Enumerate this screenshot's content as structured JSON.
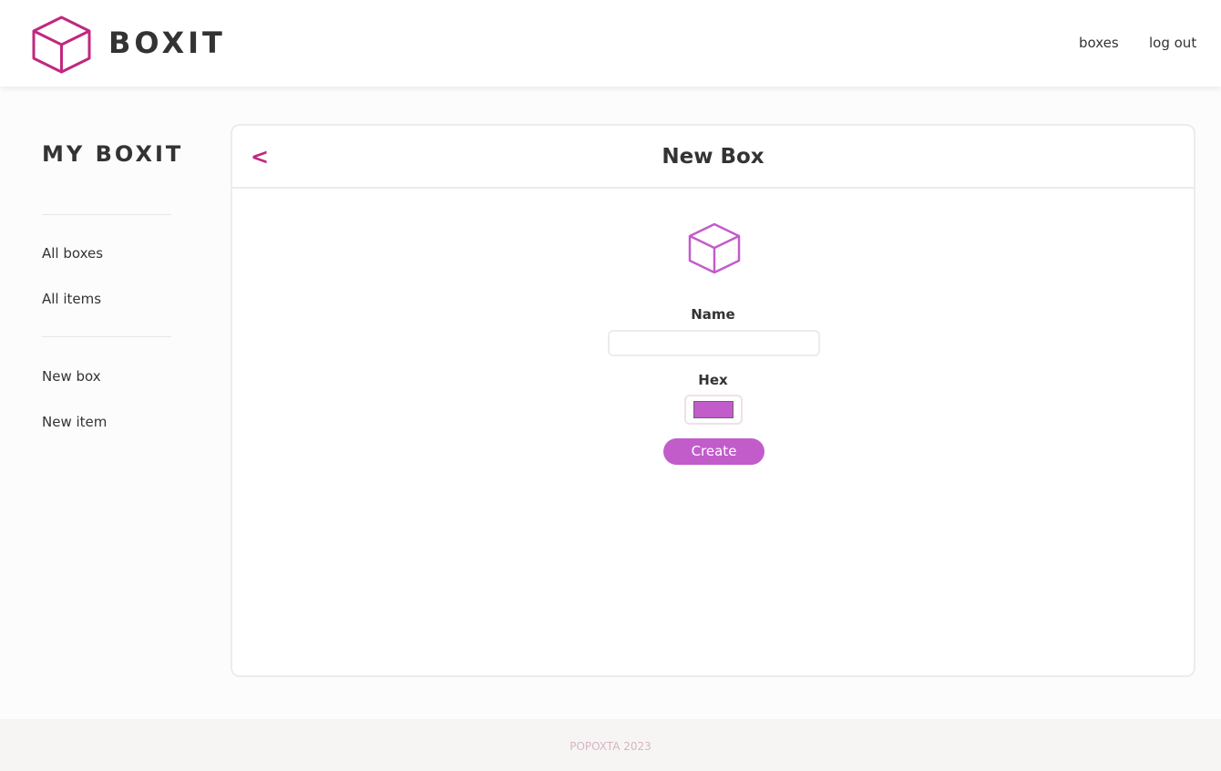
{
  "header": {
    "brand": "BOXIT",
    "nav": {
      "boxes": "boxes",
      "logout": "log out"
    }
  },
  "sidebar": {
    "title": "MY BOXIT",
    "items": [
      {
        "label": "All boxes"
      },
      {
        "label": "All items"
      },
      {
        "label": "New box"
      },
      {
        "label": "New item"
      }
    ]
  },
  "main": {
    "back_label": "<",
    "title": "New Box",
    "form": {
      "name_label": "Name",
      "name_value": "",
      "hex_label": "Hex",
      "hex_value": "#c25ccb",
      "create_label": "Create"
    }
  },
  "footer": {
    "text": "POPOXTA 2023"
  },
  "colors": {
    "accent": "#c0287f",
    "button": "#c25ccb",
    "icon": "#c25ccb"
  },
  "icons": {
    "logo": "cube-icon",
    "form": "cube-icon"
  }
}
